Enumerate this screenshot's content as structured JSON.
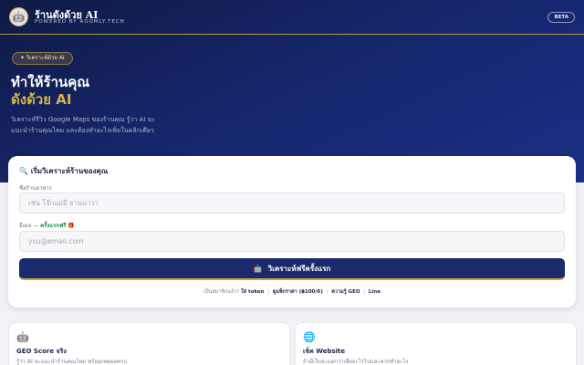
{
  "header": {
    "title": "ร้านดังด้วย AI",
    "subtitle": "POWERED BY ROOMLY.TECH",
    "badge": "BETA",
    "logo_icon": "robot-icon"
  },
  "hero": {
    "pill": "✦ วิเคราะห์ด้วย AI",
    "headline_line1": "ทำให้ร้านคุณ",
    "headline_line2": "ดังด้วย AI",
    "description_line1": "วิเคราะห์รีวิว Google Maps ของร้านคุณ รู้ว่า AI จะ",
    "description_line2": "แนะนำร้านคุณไหม และต้องทำอะไรเพิ่มในคลิกเดียว"
  },
  "form": {
    "title": "🔍 เริ่มวิเคราะห์ร้านของคุณ",
    "name_label": "ชื่อร้านอาหาร",
    "name_placeholder": "เช่น โจ๊กแม่มี่ ยานนาวา",
    "email_label_prefix": "อีเมล — ",
    "email_label_highlight": "ครั้งแรกฟรี",
    "email_label_suffix": " 🎁",
    "email_placeholder": "you@email.com",
    "cta_icon": "🤖",
    "cta_label": "วิเคราะห์ฟรีครั้งแรก"
  },
  "footer_links": {
    "prefix": "เป็นสมาชิกแล้ว?",
    "link1": "ใส่ token",
    "link2": "ดูแพ็กราคา (฿100/6)",
    "link3": "ความรู้ GEO",
    "link4": "Line"
  },
  "features": [
    {
      "icon": "🤖",
      "title": "GEO Score จริง",
      "subtitle": "รู้ว่า AI จะแนะนำร้านคุณไหม พร้อมเหตุผลครบ"
    },
    {
      "icon": "🌐",
      "title": "เช็ค Website",
      "subtitle": "ถ้ามีเว็บจะบอกว่าเสียอะไรไปและควรทำอะไร"
    }
  ],
  "colors": {
    "hero_bg": "#15266a",
    "accent_gold": "#d7b24a",
    "cta_bg": "#1b2a6b",
    "highlight_green": "#1e8f4a"
  }
}
